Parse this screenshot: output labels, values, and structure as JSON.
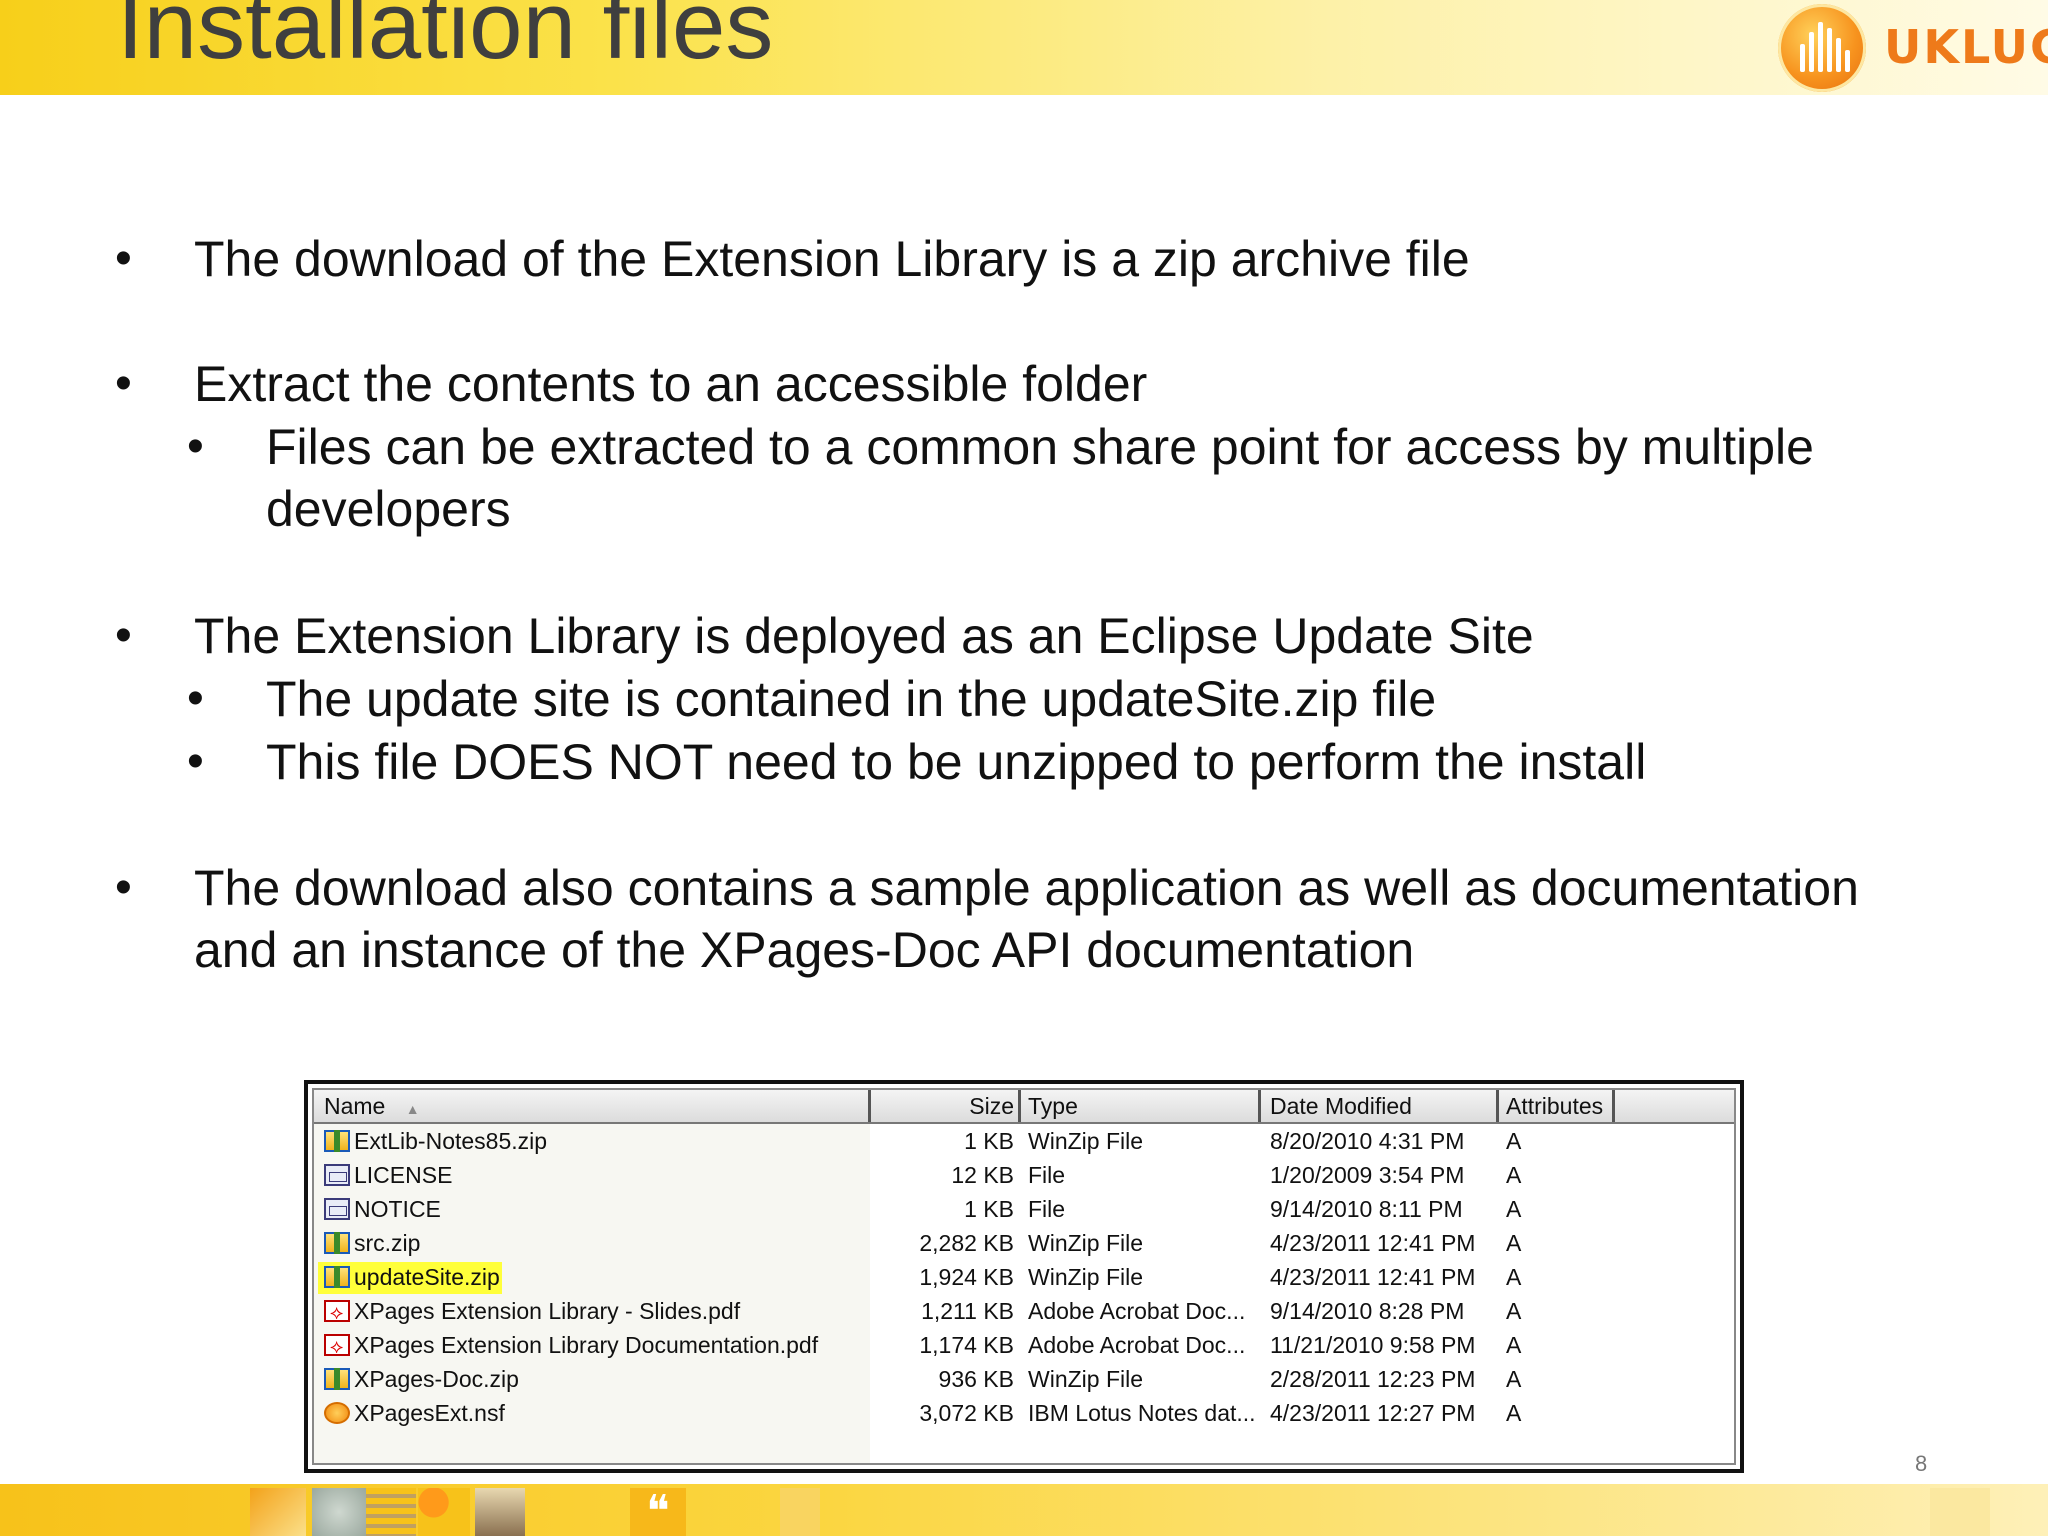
{
  "slide": {
    "title": "Installation files",
    "logo_text": "UKLUG",
    "page_number": "8"
  },
  "bullets": [
    {
      "level": 1,
      "lines": [
        "The download of the Extension Library is a zip archive file"
      ]
    },
    {
      "level": 1,
      "lines": [
        "Extract the contents to an accessible folder"
      ]
    },
    {
      "level": 2,
      "lines": [
        "Files can be extracted to a common share point for access by multiple",
        "developers"
      ]
    },
    {
      "level": 1,
      "lines": [
        "The Extension Library is deployed as an Eclipse Update Site"
      ]
    },
    {
      "level": 2,
      "lines": [
        "The update site is contained in the updateSite.zip file"
      ]
    },
    {
      "level": 2,
      "lines": [
        "This file DOES NOT need to be unzipped to perform the install"
      ]
    },
    {
      "level": 1,
      "lines": [
        "The download also contains a sample application as well as documentation",
        "and an instance of the XPages-Doc API documentation"
      ]
    }
  ],
  "explorer": {
    "columns": {
      "name": "Name",
      "size": "Size",
      "type": "Type",
      "date": "Date Modified",
      "attributes": "Attributes"
    },
    "rows": [
      {
        "icon": "winzip-icon",
        "name": "ExtLib-Notes85.zip",
        "size": "1 KB",
        "type": "WinZip File",
        "date": "8/20/2010 4:31 PM",
        "attr": "A"
      },
      {
        "icon": "file-icon",
        "name": "LICENSE",
        "size": "12 KB",
        "type": "File",
        "date": "1/20/2009 3:54 PM",
        "attr": "A"
      },
      {
        "icon": "file-icon",
        "name": "NOTICE",
        "size": "1 KB",
        "type": "File",
        "date": "9/14/2010 8:11 PM",
        "attr": "A"
      },
      {
        "icon": "winzip-icon",
        "name": "src.zip",
        "size": "2,282 KB",
        "type": "WinZip File",
        "date": "4/23/2011 12:41 PM",
        "attr": "A"
      },
      {
        "icon": "winzip-icon",
        "name": "updateSite.zip",
        "size": "1,924 KB",
        "type": "WinZip File",
        "date": "4/23/2011 12:41 PM",
        "attr": "A",
        "highlighted": true
      },
      {
        "icon": "pdf-icon",
        "name": "XPages Extension Library - Slides.pdf",
        "size": "1,211 KB",
        "type": "Adobe Acrobat Doc...",
        "date": "9/14/2010 8:28 PM",
        "attr": "A"
      },
      {
        "icon": "pdf-icon",
        "name": "XPages Extension Library Documentation.pdf",
        "size": "1,174 KB",
        "type": "Adobe Acrobat Doc...",
        "date": "11/21/2010 9:58 PM",
        "attr": "A"
      },
      {
        "icon": "winzip-icon",
        "name": "XPages-Doc.zip",
        "size": "936 KB",
        "type": "WinZip File",
        "date": "2/28/2011 12:23 PM",
        "attr": "A"
      },
      {
        "icon": "notes-db-icon",
        "name": "XPagesExt.nsf",
        "size": "3,072 KB",
        "type": "IBM Lotus Notes dat...",
        "date": "4/23/2011 12:27 PM",
        "attr": "A"
      }
    ],
    "highlight_color": "#ffff3a"
  },
  "colors": {
    "accent": "#f7cf1a",
    "logo": "#ee7a1a",
    "title": "#3f3f3f"
  }
}
